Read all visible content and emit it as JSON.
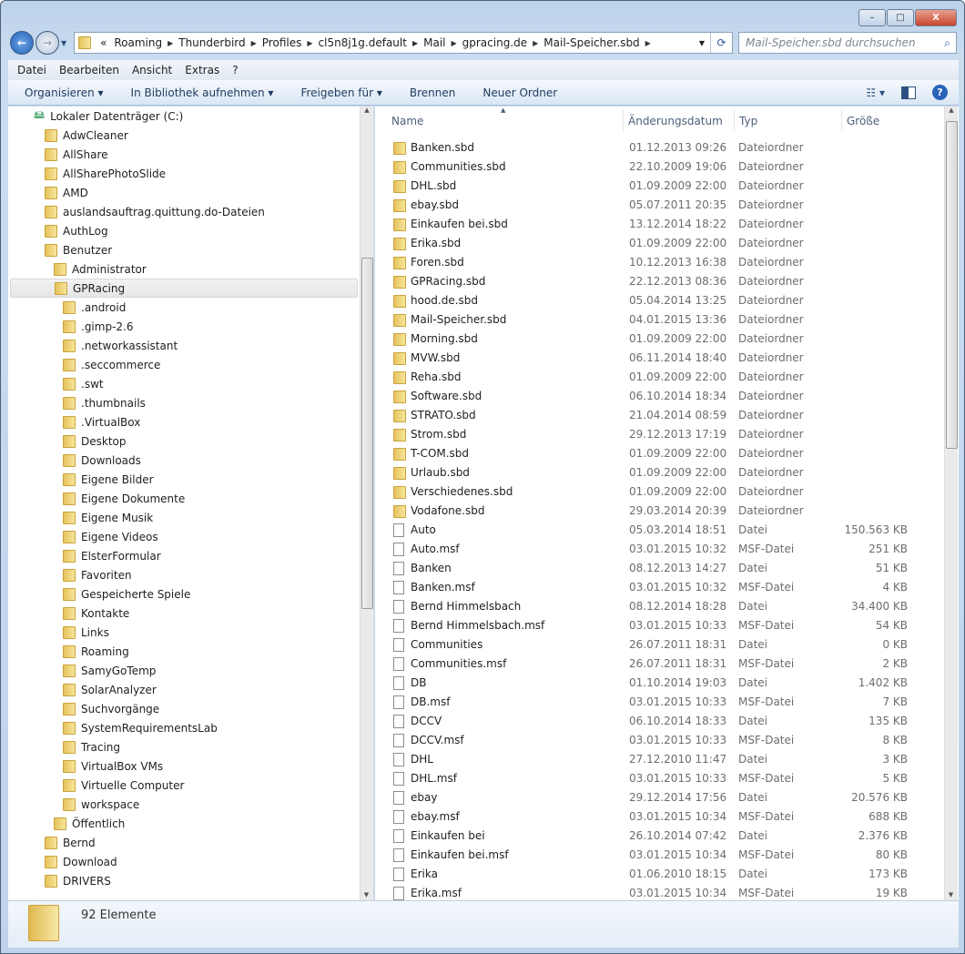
{
  "window": {
    "minimize": "–",
    "maximize": "□",
    "close": "X"
  },
  "address": {
    "overflow": "«",
    "crumbs": [
      "Roaming",
      "Thunderbird",
      "Profiles",
      "cl5n8j1g.default",
      "Mail",
      "gpracing.de",
      "Mail-Speicher.sbd"
    ]
  },
  "search": {
    "placeholder": "Mail-Speicher.sbd durchsuchen"
  },
  "menu": [
    "Datei",
    "Bearbeiten",
    "Ansicht",
    "Extras",
    "?"
  ],
  "toolbar": {
    "organize": "Organisieren ▾",
    "library": "In Bibliothek aufnehmen ▾",
    "share": "Freigeben für ▾",
    "burn": "Brennen",
    "new_folder": "Neuer Ordner"
  },
  "tree": [
    {
      "label": "Lokaler Datenträger (C:)",
      "level": 0
    },
    {
      "label": "AdwCleaner",
      "level": 1
    },
    {
      "label": "AllShare",
      "level": 1
    },
    {
      "label": "AllSharePhotoSlide",
      "level": 1
    },
    {
      "label": "AMD",
      "level": 1
    },
    {
      "label": "auslandsauftrag.quittung.do-Dateien",
      "level": 1
    },
    {
      "label": "AuthLog",
      "level": 1
    },
    {
      "label": "Benutzer",
      "level": 1
    },
    {
      "label": "Administrator",
      "level": 2
    },
    {
      "label": "GPRacing",
      "level": 2,
      "selected": true
    },
    {
      "label": ".android",
      "level": 3
    },
    {
      "label": ".gimp-2.6",
      "level": 3
    },
    {
      "label": ".networkassistant",
      "level": 3
    },
    {
      "label": ".seccommerce",
      "level": 3
    },
    {
      "label": ".swt",
      "level": 3
    },
    {
      "label": ".thumbnails",
      "level": 3
    },
    {
      "label": ".VirtualBox",
      "level": 3
    },
    {
      "label": "Desktop",
      "level": 3
    },
    {
      "label": "Downloads",
      "level": 3
    },
    {
      "label": "Eigene Bilder",
      "level": 3
    },
    {
      "label": "Eigene Dokumente",
      "level": 3
    },
    {
      "label": "Eigene Musik",
      "level": 3
    },
    {
      "label": "Eigene Videos",
      "level": 3
    },
    {
      "label": "ElsterFormular",
      "level": 3
    },
    {
      "label": "Favoriten",
      "level": 3
    },
    {
      "label": "Gespeicherte Spiele",
      "level": 3
    },
    {
      "label": "Kontakte",
      "level": 3
    },
    {
      "label": "Links",
      "level": 3
    },
    {
      "label": "Roaming",
      "level": 3
    },
    {
      "label": "SamyGoTemp",
      "level": 3
    },
    {
      "label": "SolarAnalyzer",
      "level": 3
    },
    {
      "label": "Suchvorgänge",
      "level": 3
    },
    {
      "label": "SystemRequirementsLab",
      "level": 3
    },
    {
      "label": "Tracing",
      "level": 3
    },
    {
      "label": "VirtualBox VMs",
      "level": 3
    },
    {
      "label": "Virtuelle Computer",
      "level": 3
    },
    {
      "label": "workspace",
      "level": 3
    },
    {
      "label": "Öffentlich",
      "level": 2
    },
    {
      "label": "Bernd",
      "level": 1
    },
    {
      "label": "Download",
      "level": 1
    },
    {
      "label": "DRIVERS",
      "level": 1
    }
  ],
  "columns": {
    "name": "Name",
    "date": "Änderungsdatum",
    "type": "Typ",
    "size": "Größe"
  },
  "files": [
    {
      "name": "Banken.sbd",
      "date": "01.12.2013 09:26",
      "type": "Dateiordner",
      "size": "",
      "folder": true
    },
    {
      "name": "Communities.sbd",
      "date": "22.10.2009 19:06",
      "type": "Dateiordner",
      "size": "",
      "folder": true
    },
    {
      "name": "DHL.sbd",
      "date": "01.09.2009 22:00",
      "type": "Dateiordner",
      "size": "",
      "folder": true
    },
    {
      "name": "ebay.sbd",
      "date": "05.07.2011 20:35",
      "type": "Dateiordner",
      "size": "",
      "folder": true
    },
    {
      "name": "Einkaufen bei.sbd",
      "date": "13.12.2014 18:22",
      "type": "Dateiordner",
      "size": "",
      "folder": true
    },
    {
      "name": "Erika.sbd",
      "date": "01.09.2009 22:00",
      "type": "Dateiordner",
      "size": "",
      "folder": true
    },
    {
      "name": "Foren.sbd",
      "date": "10.12.2013 16:38",
      "type": "Dateiordner",
      "size": "",
      "folder": true
    },
    {
      "name": "GPRacing.sbd",
      "date": "22.12.2013 08:36",
      "type": "Dateiordner",
      "size": "",
      "folder": true
    },
    {
      "name": "hood.de.sbd",
      "date": "05.04.2014 13:25",
      "type": "Dateiordner",
      "size": "",
      "folder": true
    },
    {
      "name": "Mail-Speicher.sbd",
      "date": "04.01.2015 13:36",
      "type": "Dateiordner",
      "size": "",
      "folder": true
    },
    {
      "name": "Morning.sbd",
      "date": "01.09.2009 22:00",
      "type": "Dateiordner",
      "size": "",
      "folder": true
    },
    {
      "name": "MVW.sbd",
      "date": "06.11.2014 18:40",
      "type": "Dateiordner",
      "size": "",
      "folder": true
    },
    {
      "name": "Reha.sbd",
      "date": "01.09.2009 22:00",
      "type": "Dateiordner",
      "size": "",
      "folder": true
    },
    {
      "name": "Software.sbd",
      "date": "06.10.2014 18:34",
      "type": "Dateiordner",
      "size": "",
      "folder": true
    },
    {
      "name": "STRATO.sbd",
      "date": "21.04.2014 08:59",
      "type": "Dateiordner",
      "size": "",
      "folder": true
    },
    {
      "name": "Strom.sbd",
      "date": "29.12.2013 17:19",
      "type": "Dateiordner",
      "size": "",
      "folder": true
    },
    {
      "name": "T-COM.sbd",
      "date": "01.09.2009 22:00",
      "type": "Dateiordner",
      "size": "",
      "folder": true
    },
    {
      "name": "Urlaub.sbd",
      "date": "01.09.2009 22:00",
      "type": "Dateiordner",
      "size": "",
      "folder": true
    },
    {
      "name": "Verschiedenes.sbd",
      "date": "01.09.2009 22:00",
      "type": "Dateiordner",
      "size": "",
      "folder": true
    },
    {
      "name": "Vodafone.sbd",
      "date": "29.03.2014 20:39",
      "type": "Dateiordner",
      "size": "",
      "folder": true
    },
    {
      "name": "Auto",
      "date": "05.03.2014 18:51",
      "type": "Datei",
      "size": "150.563 KB"
    },
    {
      "name": "Auto.msf",
      "date": "03.01.2015 10:32",
      "type": "MSF-Datei",
      "size": "251 KB"
    },
    {
      "name": "Banken",
      "date": "08.12.2013 14:27",
      "type": "Datei",
      "size": "51 KB"
    },
    {
      "name": "Banken.msf",
      "date": "03.01.2015 10:32",
      "type": "MSF-Datei",
      "size": "4 KB"
    },
    {
      "name": "Bernd Himmelsbach",
      "date": "08.12.2014 18:28",
      "type": "Datei",
      "size": "34.400 KB"
    },
    {
      "name": "Bernd Himmelsbach.msf",
      "date": "03.01.2015 10:33",
      "type": "MSF-Datei",
      "size": "54 KB"
    },
    {
      "name": "Communities",
      "date": "26.07.2011 18:31",
      "type": "Datei",
      "size": "0 KB"
    },
    {
      "name": "Communities.msf",
      "date": "26.07.2011 18:31",
      "type": "MSF-Datei",
      "size": "2 KB"
    },
    {
      "name": "DB",
      "date": "01.10.2014 19:03",
      "type": "Datei",
      "size": "1.402 KB"
    },
    {
      "name": "DB.msf",
      "date": "03.01.2015 10:33",
      "type": "MSF-Datei",
      "size": "7 KB"
    },
    {
      "name": "DCCV",
      "date": "06.10.2014 18:33",
      "type": "Datei",
      "size": "135 KB"
    },
    {
      "name": "DCCV.msf",
      "date": "03.01.2015 10:33",
      "type": "MSF-Datei",
      "size": "8 KB"
    },
    {
      "name": "DHL",
      "date": "27.12.2010 11:47",
      "type": "Datei",
      "size": "3 KB"
    },
    {
      "name": "DHL.msf",
      "date": "03.01.2015 10:33",
      "type": "MSF-Datei",
      "size": "5 KB"
    },
    {
      "name": "ebay",
      "date": "29.12.2014 17:56",
      "type": "Datei",
      "size": "20.576 KB"
    },
    {
      "name": "ebay.msf",
      "date": "03.01.2015 10:34",
      "type": "MSF-Datei",
      "size": "688 KB"
    },
    {
      "name": "Einkaufen bei",
      "date": "26.10.2014 07:42",
      "type": "Datei",
      "size": "2.376 KB"
    },
    {
      "name": "Einkaufen bei.msf",
      "date": "03.01.2015 10:34",
      "type": "MSF-Datei",
      "size": "80 KB"
    },
    {
      "name": "Erika",
      "date": "01.06.2010 18:15",
      "type": "Datei",
      "size": "173 KB"
    },
    {
      "name": "Erika.msf",
      "date": "03.01.2015 10:34",
      "type": "MSF-Datei",
      "size": "19 KB"
    }
  ],
  "status": {
    "count": "92 Elemente"
  }
}
